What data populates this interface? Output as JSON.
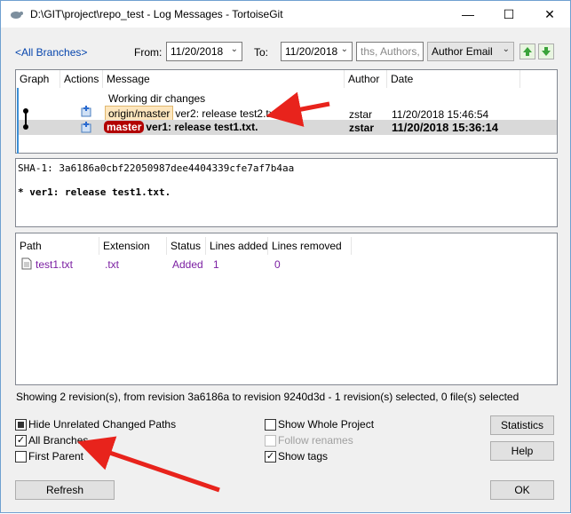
{
  "window": {
    "title": "D:\\GIT\\project\\repo_test - Log Messages - TortoiseGit"
  },
  "toolbar": {
    "all_branches_link": "<All Branches>",
    "from_label": "From:",
    "from_date": "11/20/2018",
    "to_label": "To:",
    "to_date": "11/20/2018",
    "search_placeholder": "ths, Authors, E",
    "filter_field": "Author Email"
  },
  "log": {
    "headers": [
      "Graph",
      "Actions",
      "Message",
      "Author",
      "Date"
    ],
    "rows": [
      {
        "message": "Working dir changes",
        "author": "",
        "date": ""
      },
      {
        "tag": "origin/master",
        "message": "ver2: release test2.txt.",
        "author": "zstar",
        "date": "11/20/2018 15:46:54"
      },
      {
        "tag": "master",
        "message": "ver1: release test1.txt.",
        "author": "zstar",
        "date": "11/20/2018 15:36:14"
      }
    ]
  },
  "details": {
    "sha": "SHA-1: 3a6186a0cbf22050987dee4404339cfe7af7b4aa",
    "message": "* ver1: release test1.txt."
  },
  "files": {
    "headers": [
      "Path",
      "Extension",
      "Status",
      "Lines added",
      "Lines removed"
    ],
    "rows": [
      {
        "path": "test1.txt",
        "extension": ".txt",
        "status": "Added",
        "added": "1",
        "removed": "0"
      }
    ]
  },
  "status_text": "Showing 2 revision(s), from revision 3a6186a to revision 9240d3d - 1 revision(s) selected, 0 file(s) selected",
  "options": {
    "hide_unrelated": "Hide Unrelated Changed Paths",
    "all_branches": "All Branches",
    "first_parent": "First Parent",
    "show_whole_project": "Show Whole Project",
    "follow_renames": "Follow renames",
    "show_tags": "Show tags"
  },
  "buttons": {
    "statistics": "Statistics",
    "help": "Help",
    "refresh": "Refresh",
    "ok": "OK"
  },
  "colors": {
    "link": "#0645ad",
    "master_tag": "#b20000",
    "origin_tag": "#fde6bd",
    "file_text": "#7b1fa2",
    "arrow": "#e8231c"
  }
}
